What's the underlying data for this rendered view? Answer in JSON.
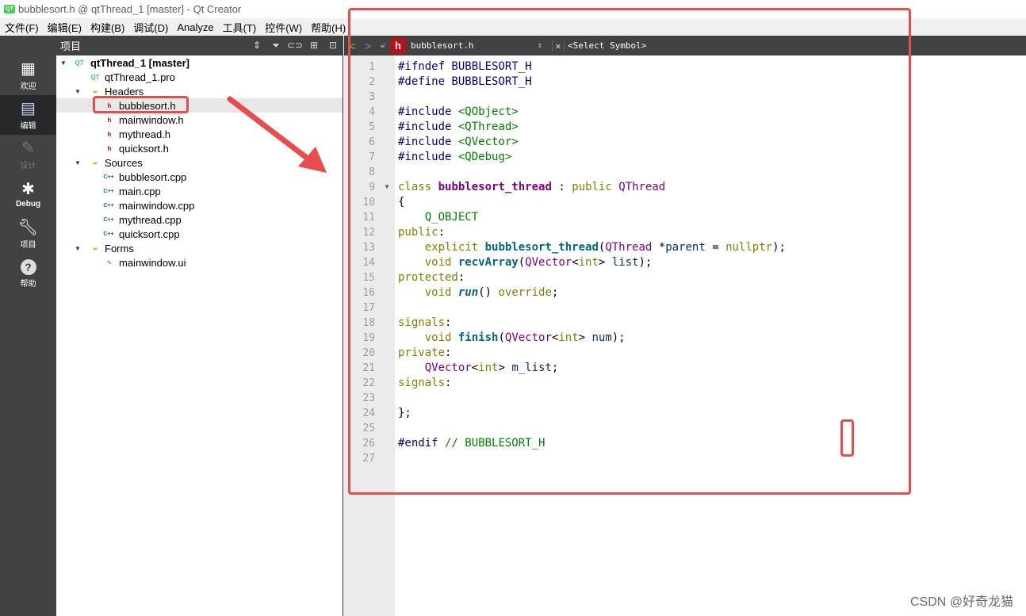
{
  "window": {
    "title": "bubblesort.h @ qtThread_1 [master] - Qt Creator",
    "app_icon": "qt-icon"
  },
  "menubar": [
    "文件(F)",
    "编辑(E)",
    "构建(B)",
    "调试(D)",
    "Analyze",
    "工具(T)",
    "控件(W)",
    "帮助(H)"
  ],
  "modes": [
    {
      "label": "欢迎",
      "icon": "grid-icon"
    },
    {
      "label": "编辑",
      "icon": "document-icon"
    },
    {
      "label": "设计",
      "icon": "pen-icon"
    },
    {
      "label": "Debug",
      "icon": "bug-icon"
    },
    {
      "label": "项目",
      "icon": "wrench-icon"
    },
    {
      "label": "帮助",
      "icon": "help-icon"
    }
  ],
  "project_panel": {
    "title": "项目"
  },
  "tree": [
    {
      "text": "qtThread_1 [master]",
      "icon": "pro"
    },
    {
      "text": "qtThread_1.pro",
      "icon": "pro"
    },
    {
      "text": "Headers",
      "icon": "folder"
    },
    {
      "text": "bubblesort.h",
      "icon": "h"
    },
    {
      "text": "mainwindow.h",
      "icon": "h"
    },
    {
      "text": "mythread.h",
      "icon": "h"
    },
    {
      "text": "quicksort.h",
      "icon": "h"
    },
    {
      "text": "Sources",
      "icon": "folder"
    },
    {
      "text": "bubblesort.cpp",
      "icon": "cpp"
    },
    {
      "text": "main.cpp",
      "icon": "cpp"
    },
    {
      "text": "mainwindow.cpp",
      "icon": "cpp"
    },
    {
      "text": "mythread.cpp",
      "icon": "cpp"
    },
    {
      "text": "quicksort.cpp",
      "icon": "cpp"
    },
    {
      "text": "Forms",
      "icon": "folder"
    },
    {
      "text": "mainwindow.ui",
      "icon": "ui"
    }
  ],
  "editor": {
    "file_name": "bubblesort.h",
    "file_icon_letter": "h",
    "symbol_placeholder": "<Select Symbol>",
    "line_numbers": [
      "1",
      "2",
      "3",
      "4",
      "5",
      "6",
      "7",
      "8",
      "9",
      "10",
      "11",
      "12",
      "13",
      "14",
      "15",
      "16",
      "17",
      "18",
      "19",
      "20",
      "21",
      "22",
      "23",
      "24",
      "25",
      "26",
      "27"
    ]
  },
  "watermark": "CSDN @好奇龙猫",
  "colors": {
    "annotation": "#e84c4c",
    "sidebar": "#404244",
    "gutter": "#ebebeb"
  }
}
